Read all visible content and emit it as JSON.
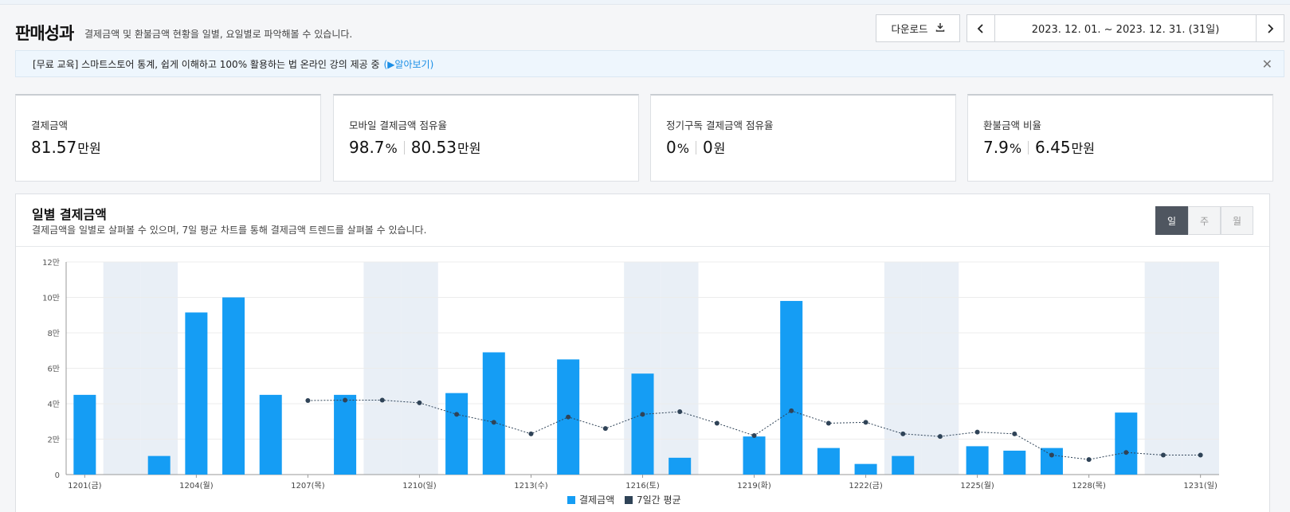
{
  "header": {
    "title": "판매성과",
    "description": "결제금액 및 환불금액 현황을 일별, 요일별로 파악해볼 수 있습니다.",
    "download_label": "다운로드",
    "date_range": "2023. 12. 01. ~ 2023. 12. 31. (31일)"
  },
  "notice": {
    "text": "[무료 교육] 스마트스토어 통계, 쉽게 이해하고 100% 활용하는 법 온라인 강의 제공 중",
    "link": "(▶알아보기)"
  },
  "cards": [
    {
      "label": "결제금액",
      "value": "81.57",
      "unit": "만원"
    },
    {
      "label": "모바일 결제금액 점유율",
      "value": "98.7",
      "unit": "%",
      "value2": "80.53",
      "unit2": "만원"
    },
    {
      "label": "정기구독 결제금액 점유율",
      "value": "0",
      "unit": "%",
      "value2": "0",
      "unit2": "원"
    },
    {
      "label": "환불금액 비율",
      "value": "7.9",
      "unit": "%",
      "value2": "6.45",
      "unit2": "만원"
    }
  ],
  "chart_panel": {
    "title": "일별 결제금액",
    "description": "결제금액을 일별로 살펴볼 수 있으며, 7일 평균 차트를 통해 결제금액 트렌드를 살펴볼 수 있습니다.",
    "period_tabs": [
      "일",
      "주",
      "월"
    ],
    "active_tab": "일"
  },
  "colors": {
    "bar": "#159df4",
    "line": "#2f4357",
    "weekend_band": "#e9eff6"
  },
  "chart_data": {
    "type": "bar",
    "y_tick_labels": [
      "0",
      "2만",
      "4만",
      "6만",
      "8만",
      "10만",
      "12만"
    ],
    "ylim": [
      0,
      120000
    ],
    "x_tick_labels": [
      "1201(금)",
      "1204(월)",
      "1207(목)",
      "1210(일)",
      "1213(수)",
      "1216(토)",
      "1219(화)",
      "1222(금)",
      "1225(월)",
      "1228(목)",
      "1231(일)"
    ],
    "x_tick_days": [
      1,
      4,
      7,
      10,
      13,
      16,
      19,
      22,
      25,
      28,
      31
    ],
    "weekend_days": [
      2,
      3,
      9,
      10,
      16,
      17,
      23,
      24,
      30,
      31
    ],
    "days": [
      1,
      2,
      3,
      4,
      5,
      6,
      7,
      8,
      9,
      10,
      11,
      12,
      13,
      14,
      15,
      16,
      17,
      18,
      19,
      20,
      21,
      22,
      23,
      24,
      25,
      26,
      27,
      28,
      29,
      30,
      31
    ],
    "series": [
      {
        "name": "결제금액",
        "type": "bar",
        "values": [
          45000,
          0,
          10500,
          91500,
          100000,
          45000,
          0,
          45000,
          0,
          0,
          46000,
          69000,
          0,
          65000,
          0,
          57000,
          9500,
          0,
          21500,
          98000,
          15000,
          6000,
          10500,
          0,
          16000,
          13500,
          15000,
          0,
          35000,
          0,
          0
        ]
      },
      {
        "name": "7일간 평균",
        "type": "line",
        "values": [
          null,
          null,
          null,
          null,
          null,
          null,
          41800,
          42000,
          42000,
          40500,
          34000,
          29500,
          23000,
          32500,
          26000,
          34000,
          35500,
          29000,
          22000,
          36000,
          29000,
          29500,
          23000,
          21500,
          24000,
          23000,
          11000,
          8500,
          12500,
          11000,
          11000
        ]
      }
    ]
  }
}
